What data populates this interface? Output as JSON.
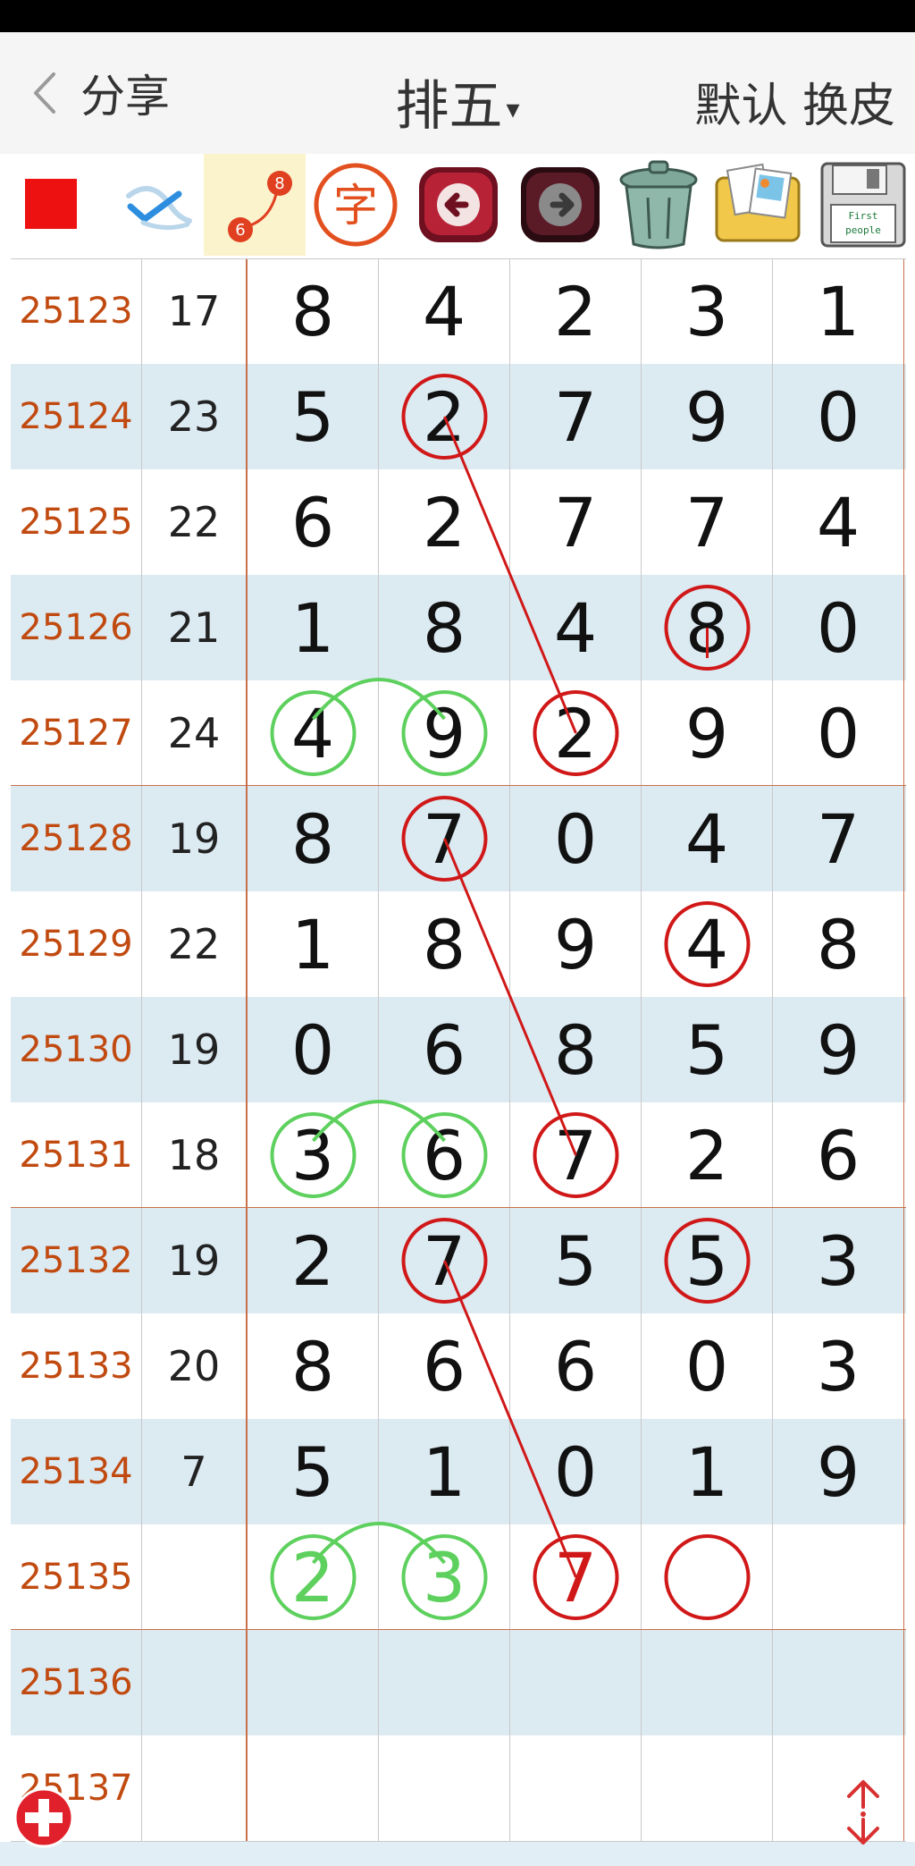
{
  "header": {
    "back_label": "分享",
    "title": "排五",
    "title_caret": "▾",
    "skin_label": "默认 换皮"
  },
  "toolbar": {
    "tools": [
      {
        "name": "color-red-square-icon"
      },
      {
        "name": "pen-check-icon"
      },
      {
        "name": "connect-line-icon",
        "badge_top": "8",
        "badge_bottom": "6"
      },
      {
        "name": "text-tool-icon",
        "glyph": "字"
      },
      {
        "name": "undo-arrow-icon"
      },
      {
        "name": "redo-arrow-icon"
      },
      {
        "name": "trash-can-icon"
      },
      {
        "name": "photo-album-icon"
      },
      {
        "name": "save-disk-icon",
        "disk_text_1": "First",
        "disk_text_2": "people"
      }
    ]
  },
  "table": {
    "rows": [
      {
        "issue": "25123",
        "sum": "17",
        "digits": [
          "8",
          "4",
          "2",
          "3",
          "1"
        ]
      },
      {
        "issue": "25124",
        "sum": "23",
        "digits": [
          "5",
          "2",
          "7",
          "9",
          "0"
        ]
      },
      {
        "issue": "25125",
        "sum": "22",
        "digits": [
          "6",
          "2",
          "7",
          "7",
          "4"
        ]
      },
      {
        "issue": "25126",
        "sum": "21",
        "digits": [
          "1",
          "8",
          "4",
          "8",
          "0"
        ]
      },
      {
        "issue": "25127",
        "sum": "24",
        "digits": [
          "4",
          "9",
          "2",
          "9",
          "0"
        ]
      },
      {
        "issue": "25128",
        "sum": "19",
        "digits": [
          "8",
          "7",
          "0",
          "4",
          "7"
        ]
      },
      {
        "issue": "25129",
        "sum": "22",
        "digits": [
          "1",
          "8",
          "9",
          "4",
          "8"
        ]
      },
      {
        "issue": "25130",
        "sum": "19",
        "digits": [
          "0",
          "6",
          "8",
          "5",
          "9"
        ]
      },
      {
        "issue": "25131",
        "sum": "18",
        "digits": [
          "3",
          "6",
          "7",
          "2",
          "6"
        ]
      },
      {
        "issue": "25132",
        "sum": "19",
        "digits": [
          "2",
          "7",
          "5",
          "5",
          "3"
        ]
      },
      {
        "issue": "25133",
        "sum": "20",
        "digits": [
          "8",
          "6",
          "6",
          "0",
          "3"
        ]
      },
      {
        "issue": "25134",
        "sum": "7",
        "digits": [
          "5",
          "1",
          "0",
          "1",
          "9"
        ]
      },
      {
        "issue": "25135",
        "sum": "",
        "digits": [
          "2",
          "3",
          "7",
          "",
          ""
        ]
      },
      {
        "issue": "25136",
        "sum": "",
        "digits": [
          "",
          "",
          "",
          "",
          ""
        ]
      },
      {
        "issue": "25137",
        "sum": "",
        "digits": [
          "",
          "",
          "",
          "",
          ""
        ]
      }
    ]
  },
  "colors": {
    "issue_text": "#c14a10",
    "row_shade": "#dceaf2",
    "red_mark": "#d01818",
    "green_mark": "#5dd05d",
    "separator_red": "#c8704b"
  },
  "annotations": {
    "red_circles": [
      {
        "row": 1,
        "col": 1
      },
      {
        "row": 3,
        "col": 3
      },
      {
        "row": 4,
        "col": 2
      },
      {
        "row": 5,
        "col": 1
      },
      {
        "row": 6,
        "col": 3
      },
      {
        "row": 8,
        "col": 2
      },
      {
        "row": 9,
        "col": 1
      },
      {
        "row": 9,
        "col": 3
      },
      {
        "row": 12,
        "col": 2
      },
      {
        "row": 12,
        "col": 3
      }
    ],
    "green_circles": [
      {
        "row": 4,
        "col": 0
      },
      {
        "row": 4,
        "col": 1
      },
      {
        "row": 8,
        "col": 0
      },
      {
        "row": 8,
        "col": 1
      },
      {
        "row": 12,
        "col": 0
      },
      {
        "row": 12,
        "col": 1
      }
    ],
    "red_lines": [
      {
        "from": {
          "row": 1,
          "col": 1
        },
        "to": {
          "row": 4,
          "col": 2
        }
      },
      {
        "from": {
          "row": 5,
          "col": 1
        },
        "to": {
          "row": 8,
          "col": 2
        }
      },
      {
        "from": {
          "row": 9,
          "col": 1
        },
        "to": {
          "row": 12,
          "col": 2
        }
      }
    ],
    "red_ticks": [
      {
        "row": 3,
        "col": 3
      }
    ],
    "green_arcs": [
      {
        "row": 4,
        "from_col": 0,
        "to_col": 1
      },
      {
        "row": 8,
        "from_col": 0,
        "to_col": 1
      },
      {
        "row": 12,
        "from_col": 0,
        "to_col": 1
      }
    ]
  },
  "fab": {
    "name": "add-circle-icon"
  },
  "scroll": {
    "name": "scroll-up-down-icon"
  }
}
